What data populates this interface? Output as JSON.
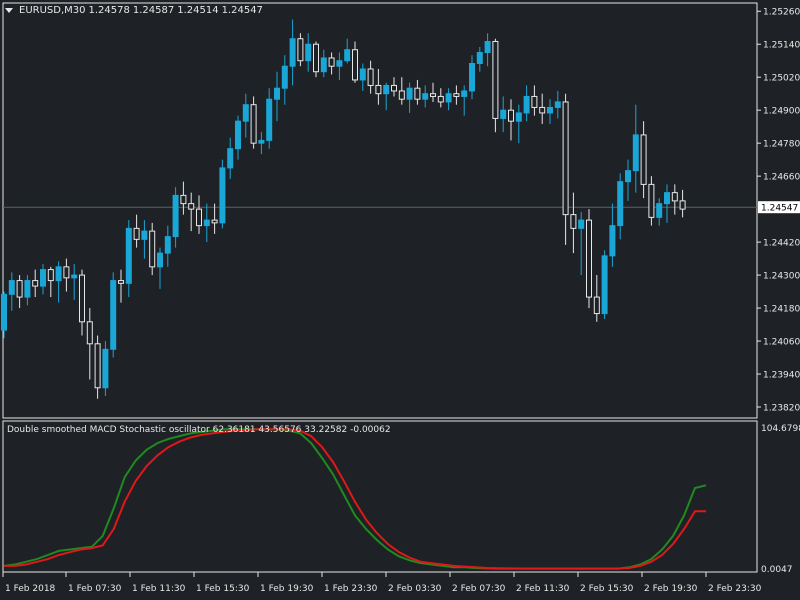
{
  "symbol": {
    "name": "EURUSD,M30",
    "open": "1.24578",
    "high": "1.24587",
    "low": "1.24514",
    "close": "1.24547"
  },
  "indicator": {
    "name": "Double smoothed MACD Stochastic oscillator",
    "values": [
      "62.36181",
      "43.56576",
      "33.22582",
      "-0.00062"
    ],
    "scale_top": "104.6798",
    "scale_bottom": "0.0047"
  },
  "price_axis": [
    "1.25260",
    "1.25140",
    "1.25020",
    "1.24900",
    "1.24780",
    "1.24660",
    "1.24420",
    "1.24300",
    "1.24180",
    "1.24060",
    "1.23940",
    "1.23820"
  ],
  "current_price": "1.24547",
  "time_axis": [
    "1 Feb 2018",
    "1 Feb 07:30",
    "1 Feb 11:30",
    "1 Feb 15:30",
    "1 Feb 19:30",
    "1 Feb 23:30",
    "2 Feb 03:30",
    "2 Feb 07:30",
    "2 Feb 11:30",
    "2 Feb 15:30",
    "2 Feb 19:30",
    "2 Feb 23:30"
  ],
  "colors": {
    "background": "#1e2125",
    "bull": "#1aa6d6",
    "bear": "#1e2125",
    "bear_outline": "#e8e8e8",
    "signal_green": "#1f8a1f",
    "signal_red": "#e01818",
    "current_line": "#4c6868"
  },
  "chart_data": [
    {
      "type": "candlestick",
      "title": "EURUSD,M30",
      "ylim": [
        1.2378,
        1.2529
      ],
      "candles": [
        [
          1.241,
          1.2424,
          1.2407,
          1.2423
        ],
        [
          1.2423,
          1.2431,
          1.2417,
          1.2428
        ],
        [
          1.2428,
          1.243,
          1.2418,
          1.2422
        ],
        [
          1.2422,
          1.243,
          1.2419,
          1.2428
        ],
        [
          1.2428,
          1.2432,
          1.2422,
          1.2426
        ],
        [
          1.2426,
          1.2434,
          1.2423,
          1.2432
        ],
        [
          1.2432,
          1.2433,
          1.2422,
          1.2428
        ],
        [
          1.2428,
          1.2435,
          1.242,
          1.2433
        ],
        [
          1.2433,
          1.2436,
          1.2424,
          1.2429
        ],
        [
          1.2429,
          1.2434,
          1.2421,
          1.243
        ],
        [
          1.243,
          1.2432,
          1.2408,
          1.2413
        ],
        [
          1.2413,
          1.2418,
          1.2392,
          1.2405
        ],
        [
          1.2405,
          1.2408,
          1.2385,
          1.2389
        ],
        [
          1.2389,
          1.2406,
          1.2386,
          1.2403
        ],
        [
          1.2403,
          1.2431,
          1.24,
          1.2428
        ],
        [
          1.2428,
          1.2432,
          1.242,
          1.2427
        ],
        [
          1.2427,
          1.245,
          1.2422,
          1.2447
        ],
        [
          1.2447,
          1.2452,
          1.244,
          1.2443
        ],
        [
          1.2443,
          1.245,
          1.2436,
          1.2446
        ],
        [
          1.2446,
          1.2449,
          1.243,
          1.2433
        ],
        [
          1.2433,
          1.244,
          1.2425,
          1.2438
        ],
        [
          1.2438,
          1.2448,
          1.2433,
          1.2444
        ],
        [
          1.2444,
          1.2462,
          1.244,
          1.2459
        ],
        [
          1.2459,
          1.2464,
          1.2452,
          1.2456
        ],
        [
          1.2456,
          1.246,
          1.2446,
          1.2454
        ],
        [
          1.2454,
          1.2459,
          1.2445,
          1.2448
        ],
        [
          1.2448,
          1.2456,
          1.2442,
          1.245
        ],
        [
          1.245,
          1.2456,
          1.2445,
          1.2449
        ],
        [
          1.2449,
          1.2472,
          1.2447,
          1.2469
        ],
        [
          1.2469,
          1.248,
          1.2465,
          1.2476
        ],
        [
          1.2476,
          1.2488,
          1.2472,
          1.2486
        ],
        [
          1.2486,
          1.2496,
          1.248,
          1.2492
        ],
        [
          1.2492,
          1.2495,
          1.2476,
          1.2478
        ],
        [
          1.2478,
          1.2482,
          1.2474,
          1.2479
        ],
        [
          1.2479,
          1.2498,
          1.2476,
          1.2494
        ],
        [
          1.2494,
          1.2504,
          1.2486,
          1.2498
        ],
        [
          1.2498,
          1.251,
          1.2492,
          1.2506
        ],
        [
          1.2506,
          1.2523,
          1.2499,
          1.2516
        ],
        [
          1.2516,
          1.2518,
          1.2506,
          1.2508
        ],
        [
          1.2508,
          1.2518,
          1.2504,
          1.2514
        ],
        [
          1.2514,
          1.2515,
          1.2502,
          1.2504
        ],
        [
          1.2504,
          1.2512,
          1.2502,
          1.2509
        ],
        [
          1.2509,
          1.2511,
          1.2503,
          1.2506
        ],
        [
          1.2506,
          1.2511,
          1.2501,
          1.2508
        ],
        [
          1.2508,
          1.2516,
          1.2507,
          1.2512
        ],
        [
          1.2512,
          1.2515,
          1.25,
          1.2501
        ],
        [
          1.2501,
          1.2507,
          1.2497,
          1.2505
        ],
        [
          1.2505,
          1.2508,
          1.2496,
          1.2499
        ],
        [
          1.2499,
          1.2505,
          1.2492,
          1.2496
        ],
        [
          1.2496,
          1.25,
          1.249,
          1.2499
        ],
        [
          1.2499,
          1.2502,
          1.2495,
          1.2497
        ],
        [
          1.2497,
          1.2502,
          1.2492,
          1.2494
        ],
        [
          1.2494,
          1.25,
          1.2489,
          1.2498
        ],
        [
          1.2498,
          1.2501,
          1.2492,
          1.2494
        ],
        [
          1.2494,
          1.2499,
          1.2491,
          1.2496
        ],
        [
          1.2496,
          1.25,
          1.2493,
          1.2495
        ],
        [
          1.2495,
          1.2498,
          1.2491,
          1.2493
        ],
        [
          1.2493,
          1.2498,
          1.249,
          1.2496
        ],
        [
          1.2496,
          1.2499,
          1.2492,
          1.2495
        ],
        [
          1.2495,
          1.2499,
          1.2488,
          1.2497
        ],
        [
          1.2497,
          1.251,
          1.2494,
          1.2507
        ],
        [
          1.2507,
          1.2513,
          1.2504,
          1.2511
        ],
        [
          1.2511,
          1.2518,
          1.2506,
          1.2515
        ],
        [
          1.2515,
          1.2516,
          1.2482,
          1.2487
        ],
        [
          1.2487,
          1.2495,
          1.2482,
          1.249
        ],
        [
          1.249,
          1.2494,
          1.2479,
          1.2486
        ],
        [
          1.2486,
          1.2492,
          1.2478,
          1.2489
        ],
        [
          1.2489,
          1.2499,
          1.2486,
          1.2495
        ],
        [
          1.2495,
          1.2499,
          1.2488,
          1.2491
        ],
        [
          1.2491,
          1.2496,
          1.2485,
          1.2489
        ],
        [
          1.2489,
          1.2494,
          1.2485,
          1.2491
        ],
        [
          1.2491,
          1.2497,
          1.2487,
          1.2493
        ],
        [
          1.2493,
          1.2496,
          1.2441,
          1.2452
        ],
        [
          1.2452,
          1.246,
          1.2438,
          1.2447
        ],
        [
          1.2447,
          1.2453,
          1.243,
          1.245
        ],
        [
          1.245,
          1.2454,
          1.2418,
          1.2422
        ],
        [
          1.2422,
          1.243,
          1.2413,
          1.2416
        ],
        [
          1.2416,
          1.2439,
          1.2414,
          1.2437
        ],
        [
          1.2437,
          1.2456,
          1.2433,
          1.2448
        ],
        [
          1.2448,
          1.2467,
          1.2443,
          1.2464
        ],
        [
          1.2464,
          1.2472,
          1.2457,
          1.2468
        ],
        [
          1.2468,
          1.2492,
          1.246,
          1.2481
        ],
        [
          1.2481,
          1.2486,
          1.2458,
          1.2463
        ],
        [
          1.2463,
          1.2466,
          1.2448,
          1.2451
        ],
        [
          1.2451,
          1.2458,
          1.2448,
          1.2456
        ],
        [
          1.2456,
          1.2463,
          1.2449,
          1.246
        ],
        [
          1.246,
          1.2463,
          1.2452,
          1.2457
        ],
        [
          1.2457,
          1.2461,
          1.2451,
          1.2454
        ]
      ]
    },
    {
      "type": "line",
      "title": "Double smoothed MACD Stochastic oscillator",
      "ylim": [
        0.0047,
        104.6798
      ],
      "series": [
        {
          "color": "#1f8a1f",
          "values": [
            3,
            4,
            6,
            8,
            11,
            14,
            15,
            16,
            17,
            25,
            45,
            68,
            80,
            88,
            93,
            96,
            98,
            100,
            101,
            102,
            103,
            103,
            103,
            103,
            103,
            103,
            102,
            100,
            93,
            82,
            70,
            55,
            40,
            30,
            22,
            15,
            10,
            7,
            5,
            4,
            3,
            2,
            2,
            1.5,
            1.2,
            1,
            1,
            1,
            1,
            1,
            1,
            1,
            1,
            1,
            1,
            1,
            1,
            2,
            4,
            8,
            15,
            25,
            40,
            60,
            62
          ]
        },
        {
          "color": "#e01818",
          "values": [
            3,
            3,
            4,
            6,
            8,
            11,
            13,
            15,
            16,
            18,
            30,
            50,
            65,
            76,
            84,
            90,
            94,
            97,
            99,
            100,
            101,
            102,
            102,
            103,
            103,
            103,
            103,
            102,
            98,
            90,
            79,
            65,
            50,
            37,
            27,
            19,
            13,
            9,
            6,
            5,
            4,
            3,
            2.5,
            2,
            1.5,
            1.3,
            1.2,
            1.1,
            1,
            1,
            1,
            1,
            1,
            1,
            1,
            1,
            1,
            1.5,
            3,
            6,
            11,
            19,
            30,
            43,
            43
          ]
        }
      ]
    }
  ]
}
